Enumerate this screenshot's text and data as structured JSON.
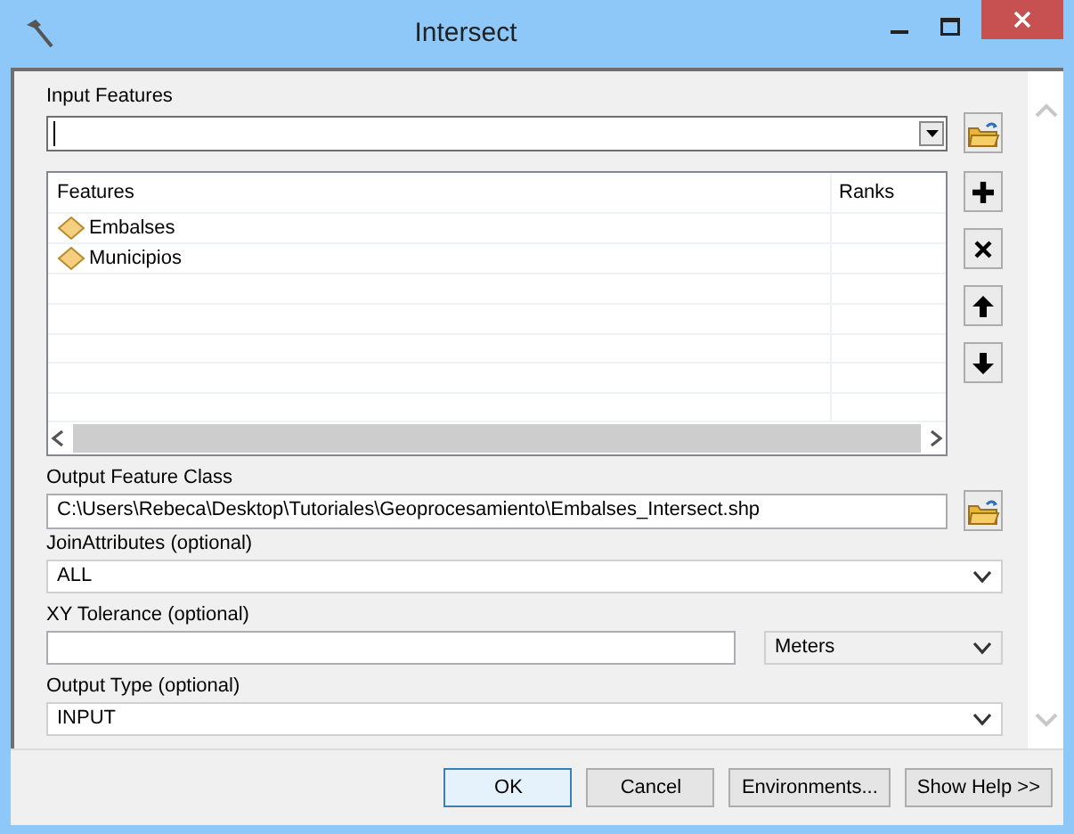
{
  "window": {
    "title": "Intersect"
  },
  "input_features": {
    "label": "Input Features",
    "has_cursor": true
  },
  "features_table": {
    "columns": [
      "Features",
      "Ranks"
    ],
    "rows": [
      {
        "name": "Embalses"
      },
      {
        "name": "Municipios"
      }
    ]
  },
  "list_buttons": [
    {
      "kind": "add"
    },
    {
      "kind": "remove"
    },
    {
      "kind": "up"
    },
    {
      "kind": "down"
    }
  ],
  "output_feature_class": {
    "label": "Output Feature Class",
    "value": "C:\\Users\\Rebeca\\Desktop\\Tutoriales\\Geoprocesamiento\\Embalses_Intersect.shp"
  },
  "join_attributes": {
    "label": "JoinAttributes (optional)",
    "value": "ALL"
  },
  "xy_tolerance": {
    "label": "XY Tolerance (optional)",
    "units": "Meters"
  },
  "output_type": {
    "label": "Output Type (optional)",
    "value": "INPUT"
  },
  "buttons": [
    {
      "label": "OK",
      "focused": true
    },
    {
      "label": "Cancel",
      "focused": false
    },
    {
      "label": "Environments...",
      "focused": false
    },
    {
      "label": "Show Help >>",
      "focused": false
    }
  ]
}
